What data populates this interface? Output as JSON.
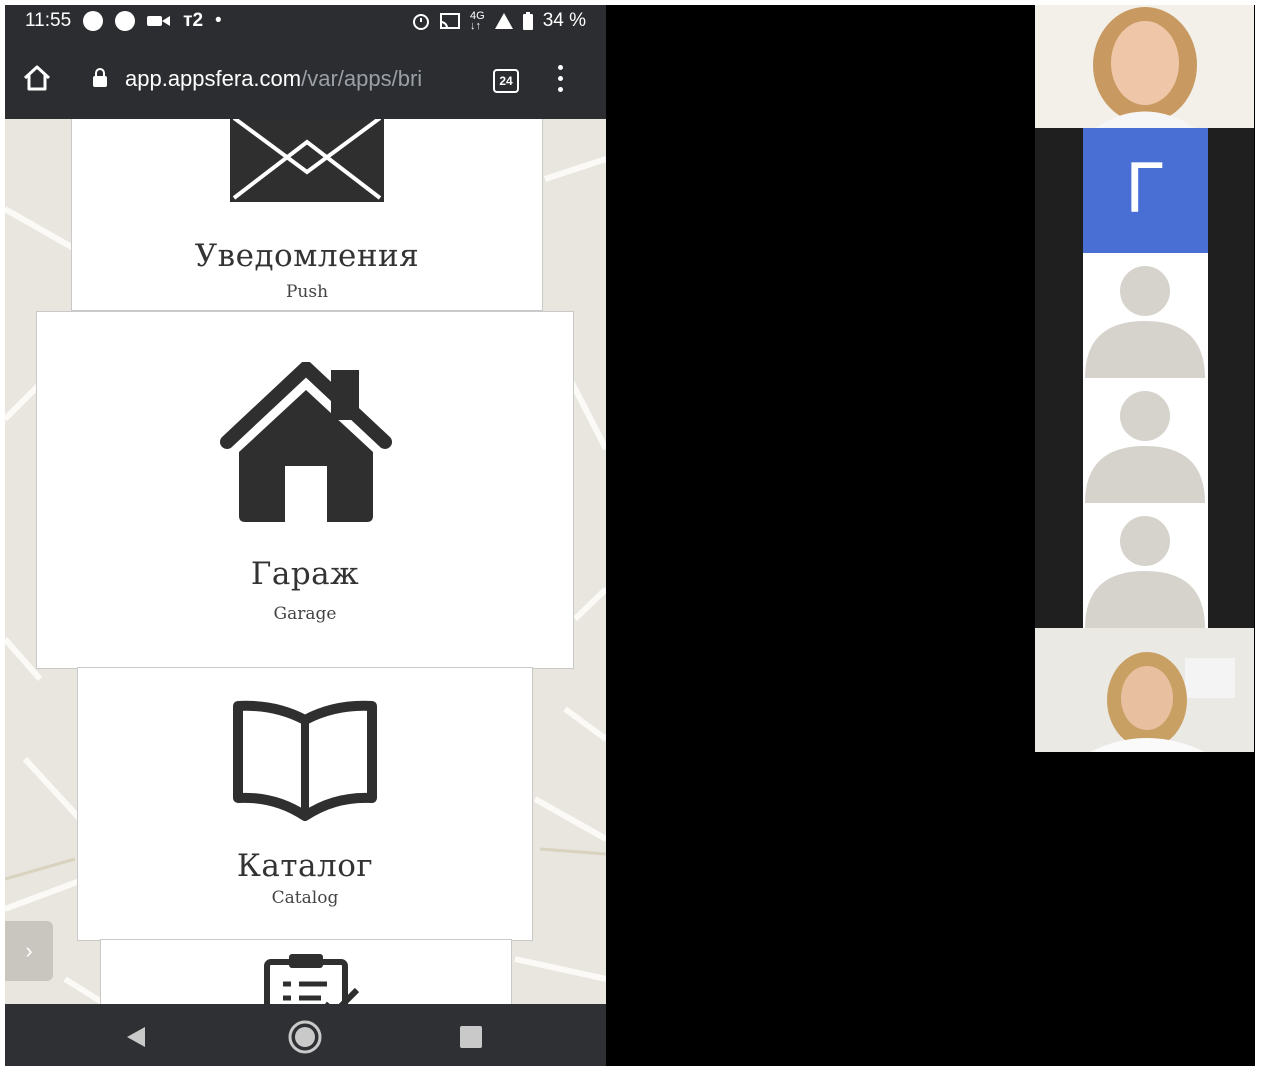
{
  "status_bar": {
    "time": "11:55",
    "carrier": "т2",
    "battery": "34 %",
    "icons": [
      "maps-icon",
      "circle-icon",
      "video-icon",
      "alarm-icon",
      "cast-icon",
      "4g-icon",
      "signal-icon",
      "battery-icon"
    ]
  },
  "browser": {
    "url_host": "app.appsfera.com",
    "url_path": "/var/apps/bri",
    "tab_count": "24"
  },
  "app": {
    "cards": [
      {
        "title": "Уведомления",
        "subtitle": "Push",
        "icon": "envelope-icon"
      },
      {
        "title": "Гараж",
        "subtitle": "Garage",
        "icon": "house-icon"
      },
      {
        "title": "Каталог",
        "subtitle": "Catalog",
        "icon": "book-icon"
      },
      {
        "title": "",
        "subtitle": "",
        "icon": "clipboard-icon"
      }
    ],
    "side_arrow": "›"
  },
  "participants": {
    "avatar_letter": "Г",
    "avatar_color": "#4a6fd4"
  },
  "colors": {
    "phone_bar": "#2b2d30",
    "map_bg": "#e9e6df",
    "stage_bg": "#000000"
  }
}
